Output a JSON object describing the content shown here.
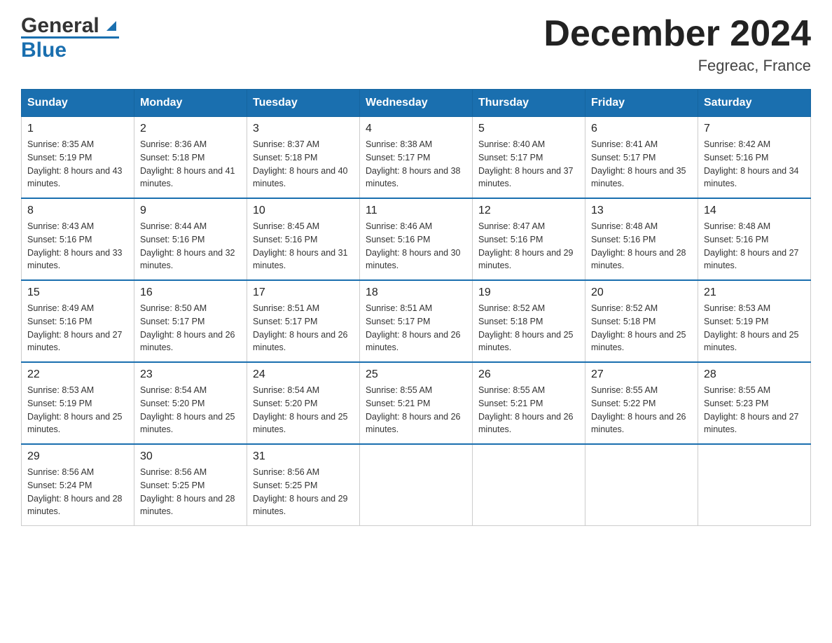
{
  "header": {
    "logo_general": "General",
    "logo_blue": "Blue",
    "month_title": "December 2024",
    "location": "Fegreac, France"
  },
  "days_of_week": [
    "Sunday",
    "Monday",
    "Tuesday",
    "Wednesday",
    "Thursday",
    "Friday",
    "Saturday"
  ],
  "weeks": [
    [
      {
        "day": "1",
        "sunrise": "Sunrise: 8:35 AM",
        "sunset": "Sunset: 5:19 PM",
        "daylight": "Daylight: 8 hours and 43 minutes."
      },
      {
        "day": "2",
        "sunrise": "Sunrise: 8:36 AM",
        "sunset": "Sunset: 5:18 PM",
        "daylight": "Daylight: 8 hours and 41 minutes."
      },
      {
        "day": "3",
        "sunrise": "Sunrise: 8:37 AM",
        "sunset": "Sunset: 5:18 PM",
        "daylight": "Daylight: 8 hours and 40 minutes."
      },
      {
        "day": "4",
        "sunrise": "Sunrise: 8:38 AM",
        "sunset": "Sunset: 5:17 PM",
        "daylight": "Daylight: 8 hours and 38 minutes."
      },
      {
        "day": "5",
        "sunrise": "Sunrise: 8:40 AM",
        "sunset": "Sunset: 5:17 PM",
        "daylight": "Daylight: 8 hours and 37 minutes."
      },
      {
        "day": "6",
        "sunrise": "Sunrise: 8:41 AM",
        "sunset": "Sunset: 5:17 PM",
        "daylight": "Daylight: 8 hours and 35 minutes."
      },
      {
        "day": "7",
        "sunrise": "Sunrise: 8:42 AM",
        "sunset": "Sunset: 5:16 PM",
        "daylight": "Daylight: 8 hours and 34 minutes."
      }
    ],
    [
      {
        "day": "8",
        "sunrise": "Sunrise: 8:43 AM",
        "sunset": "Sunset: 5:16 PM",
        "daylight": "Daylight: 8 hours and 33 minutes."
      },
      {
        "day": "9",
        "sunrise": "Sunrise: 8:44 AM",
        "sunset": "Sunset: 5:16 PM",
        "daylight": "Daylight: 8 hours and 32 minutes."
      },
      {
        "day": "10",
        "sunrise": "Sunrise: 8:45 AM",
        "sunset": "Sunset: 5:16 PM",
        "daylight": "Daylight: 8 hours and 31 minutes."
      },
      {
        "day": "11",
        "sunrise": "Sunrise: 8:46 AM",
        "sunset": "Sunset: 5:16 PM",
        "daylight": "Daylight: 8 hours and 30 minutes."
      },
      {
        "day": "12",
        "sunrise": "Sunrise: 8:47 AM",
        "sunset": "Sunset: 5:16 PM",
        "daylight": "Daylight: 8 hours and 29 minutes."
      },
      {
        "day": "13",
        "sunrise": "Sunrise: 8:48 AM",
        "sunset": "Sunset: 5:16 PM",
        "daylight": "Daylight: 8 hours and 28 minutes."
      },
      {
        "day": "14",
        "sunrise": "Sunrise: 8:48 AM",
        "sunset": "Sunset: 5:16 PM",
        "daylight": "Daylight: 8 hours and 27 minutes."
      }
    ],
    [
      {
        "day": "15",
        "sunrise": "Sunrise: 8:49 AM",
        "sunset": "Sunset: 5:16 PM",
        "daylight": "Daylight: 8 hours and 27 minutes."
      },
      {
        "day": "16",
        "sunrise": "Sunrise: 8:50 AM",
        "sunset": "Sunset: 5:17 PM",
        "daylight": "Daylight: 8 hours and 26 minutes."
      },
      {
        "day": "17",
        "sunrise": "Sunrise: 8:51 AM",
        "sunset": "Sunset: 5:17 PM",
        "daylight": "Daylight: 8 hours and 26 minutes."
      },
      {
        "day": "18",
        "sunrise": "Sunrise: 8:51 AM",
        "sunset": "Sunset: 5:17 PM",
        "daylight": "Daylight: 8 hours and 26 minutes."
      },
      {
        "day": "19",
        "sunrise": "Sunrise: 8:52 AM",
        "sunset": "Sunset: 5:18 PM",
        "daylight": "Daylight: 8 hours and 25 minutes."
      },
      {
        "day": "20",
        "sunrise": "Sunrise: 8:52 AM",
        "sunset": "Sunset: 5:18 PM",
        "daylight": "Daylight: 8 hours and 25 minutes."
      },
      {
        "day": "21",
        "sunrise": "Sunrise: 8:53 AM",
        "sunset": "Sunset: 5:19 PM",
        "daylight": "Daylight: 8 hours and 25 minutes."
      }
    ],
    [
      {
        "day": "22",
        "sunrise": "Sunrise: 8:53 AM",
        "sunset": "Sunset: 5:19 PM",
        "daylight": "Daylight: 8 hours and 25 minutes."
      },
      {
        "day": "23",
        "sunrise": "Sunrise: 8:54 AM",
        "sunset": "Sunset: 5:20 PM",
        "daylight": "Daylight: 8 hours and 25 minutes."
      },
      {
        "day": "24",
        "sunrise": "Sunrise: 8:54 AM",
        "sunset": "Sunset: 5:20 PM",
        "daylight": "Daylight: 8 hours and 25 minutes."
      },
      {
        "day": "25",
        "sunrise": "Sunrise: 8:55 AM",
        "sunset": "Sunset: 5:21 PM",
        "daylight": "Daylight: 8 hours and 26 minutes."
      },
      {
        "day": "26",
        "sunrise": "Sunrise: 8:55 AM",
        "sunset": "Sunset: 5:21 PM",
        "daylight": "Daylight: 8 hours and 26 minutes."
      },
      {
        "day": "27",
        "sunrise": "Sunrise: 8:55 AM",
        "sunset": "Sunset: 5:22 PM",
        "daylight": "Daylight: 8 hours and 26 minutes."
      },
      {
        "day": "28",
        "sunrise": "Sunrise: 8:55 AM",
        "sunset": "Sunset: 5:23 PM",
        "daylight": "Daylight: 8 hours and 27 minutes."
      }
    ],
    [
      {
        "day": "29",
        "sunrise": "Sunrise: 8:56 AM",
        "sunset": "Sunset: 5:24 PM",
        "daylight": "Daylight: 8 hours and 28 minutes."
      },
      {
        "day": "30",
        "sunrise": "Sunrise: 8:56 AM",
        "sunset": "Sunset: 5:25 PM",
        "daylight": "Daylight: 8 hours and 28 minutes."
      },
      {
        "day": "31",
        "sunrise": "Sunrise: 8:56 AM",
        "sunset": "Sunset: 5:25 PM",
        "daylight": "Daylight: 8 hours and 29 minutes."
      },
      null,
      null,
      null,
      null
    ]
  ]
}
